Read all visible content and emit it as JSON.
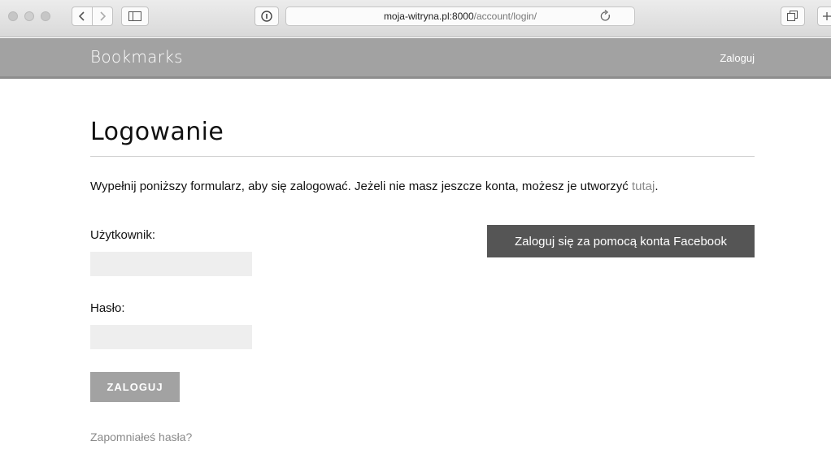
{
  "browser": {
    "url_host": "moja-witryna.pl:8000",
    "url_path": "/account/login/"
  },
  "header": {
    "brand": "Bookmarks",
    "login_link": "Zaloguj"
  },
  "main": {
    "title": "Logowanie",
    "intro_text": "Wypełnij poniższy formularz, aby się zalogować. Jeżeli nie masz jeszcze konta, możesz je utworzyć ",
    "intro_link": "tutaj",
    "intro_end": ".",
    "username_label": "Użytkownik:",
    "username_value": "",
    "password_label": "Hasło:",
    "password_value": "",
    "submit_label": "ZALOGUJ",
    "forgot_link": "Zapomniałeś hasła?",
    "facebook_button": "Zaloguj się za pomocą konta Facebook"
  },
  "colors": {
    "header_bg": "#a2a2a2",
    "facebook_button_bg": "#555555",
    "link": "#8a8a8a",
    "input_bg": "#eeeeee"
  }
}
